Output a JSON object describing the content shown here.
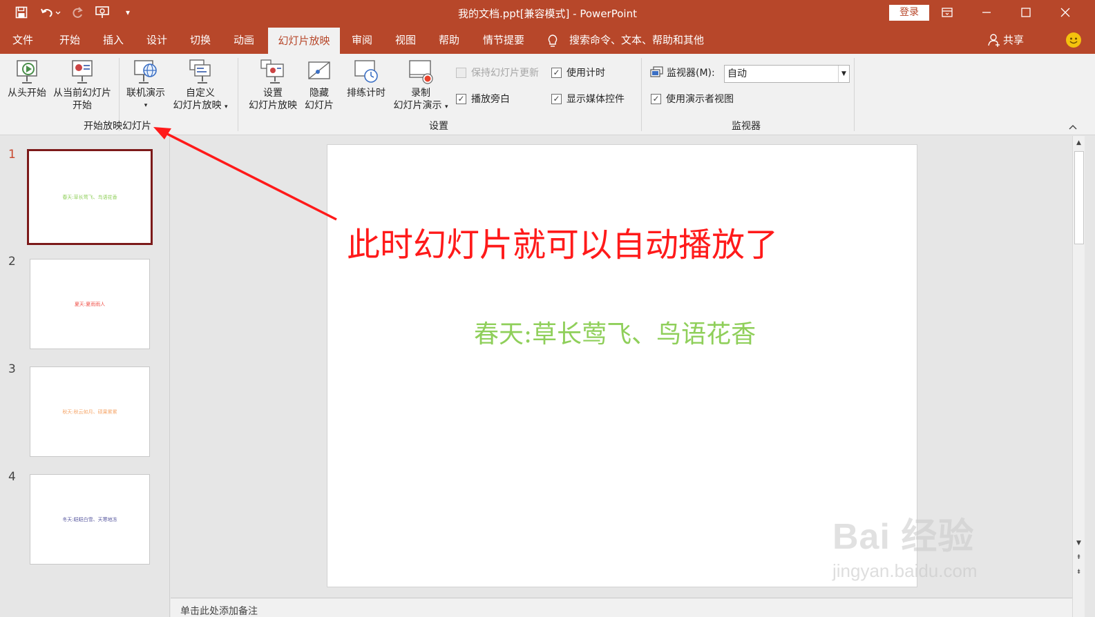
{
  "titlebar": {
    "title": "我的文档.ppt[兼容模式]  -  PowerPoint",
    "login": "登录"
  },
  "tabs": [
    "文件",
    "开始",
    "插入",
    "设计",
    "切换",
    "动画",
    "幻灯片放映",
    "审阅",
    "视图",
    "帮助",
    "情节提要"
  ],
  "tell_me": "搜索命令、文本、帮助和其他",
  "share": "共享",
  "ribbon": {
    "start_group": {
      "label": "开始放映幻灯片",
      "from_beginning": "从头开始",
      "from_current_1": "从当前幻灯片",
      "from_current_2": "开始",
      "online": "联机演示",
      "custom_1": "自定义",
      "custom_2": "幻灯片放映"
    },
    "setup_group": {
      "label": "设置",
      "setup_1": "设置",
      "setup_2": "幻灯片放映",
      "hide_1": "隐藏",
      "hide_2": "幻灯片",
      "rehearse": "排练计时",
      "record_1": "录制",
      "record_2": "幻灯片演示",
      "keep_updated": "保持幻灯片更新",
      "play_narration": "播放旁白",
      "use_timings": "使用计时",
      "show_media": "显示媒体控件"
    },
    "monitors_group": {
      "label": "监视器",
      "monitor_label": "监视器(M):",
      "monitor_value": "自动",
      "presenter_view": "使用演示者视图"
    }
  },
  "thumbnails": [
    {
      "num": "1",
      "text": "春天:草长莺飞、鸟语花香",
      "color": "#8fcf5a"
    },
    {
      "num": "2",
      "text": "夏天:夏雨雨人",
      "color": "#f0524a"
    },
    {
      "num": "3",
      "text": "秋天:秋云如月、硕果累累",
      "color": "#f5a66a"
    },
    {
      "num": "4",
      "text": "冬天:皑皑白雪、天寒地冻",
      "color": "#5a5aa0"
    }
  ],
  "slide": {
    "text": "春天:草长莺飞、鸟语花香",
    "text_color": "#8fcf5a"
  },
  "annotation": "此时幻灯片就可以自动播放了",
  "notes_placeholder": "单击此处添加备注",
  "watermark": {
    "main": "Bai 经验",
    "sub": "jingyan.baidu.com"
  },
  "colors": {
    "accent": "#b7472a",
    "annotation": "#ff1a1a"
  }
}
